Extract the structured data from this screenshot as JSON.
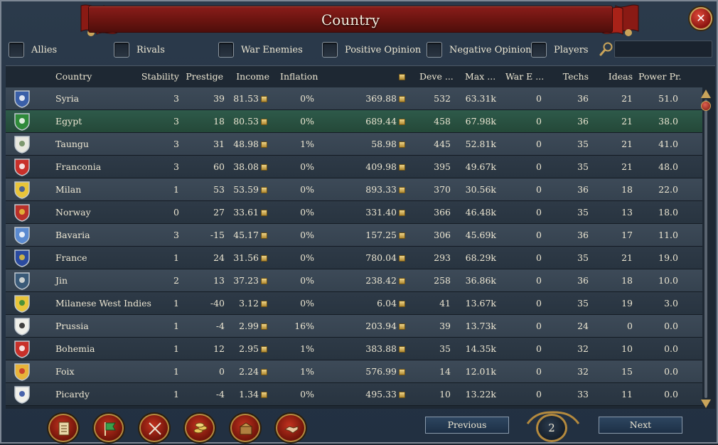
{
  "window": {
    "title": "Country"
  },
  "filters": [
    {
      "label": "Allies"
    },
    {
      "label": "Rivals"
    },
    {
      "label": "War Enemies"
    },
    {
      "label": "Positive Opinion"
    },
    {
      "label": "Negative Opinion"
    },
    {
      "label": "Players"
    }
  ],
  "search": {
    "value": "",
    "placeholder": ""
  },
  "columns": {
    "country": "Country",
    "stability": "Stability",
    "prestige": "Prestige",
    "income": "Income",
    "inflation": "Inflation",
    "treasury": "",
    "development": "Deve ...",
    "max_manpower": "Max ...",
    "war_exhaustion": "War E ...",
    "techs": "Techs",
    "ideas": "Ideas",
    "power_projection": "Power Pr."
  },
  "rows": [
    {
      "country": "Syria",
      "stability": "3",
      "prestige": "39",
      "income": "81.53",
      "inflation": "0%",
      "treasury": "369.88",
      "development": "532",
      "max_manpower": "63.31k",
      "war_exhaustion": "0",
      "techs": "36",
      "ideas": "21",
      "power_projection": "51.0",
      "flag_color": "#3a5fa8",
      "flag_accent": "#ffffff",
      "selected": false
    },
    {
      "country": "Egypt",
      "stability": "3",
      "prestige": "18",
      "income": "80.53",
      "inflation": "0%",
      "treasury": "689.44",
      "development": "458",
      "max_manpower": "67.98k",
      "war_exhaustion": "0",
      "techs": "36",
      "ideas": "21",
      "power_projection": "38.0",
      "flag_color": "#2f8a3a",
      "flag_accent": "#ffffff",
      "selected": true
    },
    {
      "country": "Taungu",
      "stability": "3",
      "prestige": "31",
      "income": "48.98",
      "inflation": "1%",
      "treasury": "58.98",
      "development": "445",
      "max_manpower": "52.81k",
      "war_exhaustion": "0",
      "techs": "35",
      "ideas": "21",
      "power_projection": "41.0",
      "flag_color": "#e8e8e0",
      "flag_accent": "#6a8a5a",
      "selected": false
    },
    {
      "country": "Franconia",
      "stability": "3",
      "prestige": "60",
      "income": "38.08",
      "inflation": "0%",
      "treasury": "409.98",
      "development": "395",
      "max_manpower": "49.67k",
      "war_exhaustion": "0",
      "techs": "35",
      "ideas": "21",
      "power_projection": "48.0",
      "flag_color": "#c8302a",
      "flag_accent": "#ffffff",
      "selected": false
    },
    {
      "country": "Milan",
      "stability": "1",
      "prestige": "53",
      "income": "53.59",
      "inflation": "0%",
      "treasury": "893.33",
      "development": "370",
      "max_manpower": "30.56k",
      "war_exhaustion": "0",
      "techs": "36",
      "ideas": "18",
      "power_projection": "22.0",
      "flag_color": "#e8c43a",
      "flag_accent": "#3050a0",
      "selected": false
    },
    {
      "country": "Norway",
      "stability": "0",
      "prestige": "27",
      "income": "33.61",
      "inflation": "0%",
      "treasury": "331.40",
      "development": "366",
      "max_manpower": "46.48k",
      "war_exhaustion": "0",
      "techs": "35",
      "ideas": "13",
      "power_projection": "18.0",
      "flag_color": "#b8302a",
      "flag_accent": "#e8c43a",
      "selected": false
    },
    {
      "country": "Bavaria",
      "stability": "3",
      "prestige": "-15",
      "income": "45.17",
      "inflation": "0%",
      "treasury": "157.25",
      "development": "306",
      "max_manpower": "45.69k",
      "war_exhaustion": "0",
      "techs": "36",
      "ideas": "17",
      "power_projection": "11.0",
      "flag_color": "#5a8ad0",
      "flag_accent": "#ffffff",
      "selected": false
    },
    {
      "country": "France",
      "stability": "1",
      "prestige": "24",
      "income": "31.56",
      "inflation": "0%",
      "treasury": "780.04",
      "development": "293",
      "max_manpower": "68.29k",
      "war_exhaustion": "0",
      "techs": "35",
      "ideas": "21",
      "power_projection": "19.0",
      "flag_color": "#2a4aa0",
      "flag_accent": "#e8c43a",
      "selected": false
    },
    {
      "country": "Jin",
      "stability": "2",
      "prestige": "13",
      "income": "37.23",
      "inflation": "0%",
      "treasury": "238.42",
      "development": "258",
      "max_manpower": "36.86k",
      "war_exhaustion": "0",
      "techs": "36",
      "ideas": "18",
      "power_projection": "10.0",
      "flag_color": "#3a5a78",
      "flag_accent": "#e8e8e0",
      "selected": false
    },
    {
      "country": "Milanese West Indies",
      "stability": "1",
      "prestige": "-40",
      "income": "3.12",
      "inflation": "0%",
      "treasury": "6.04",
      "development": "41",
      "max_manpower": "13.67k",
      "war_exhaustion": "0",
      "techs": "35",
      "ideas": "19",
      "power_projection": "3.0",
      "flag_color": "#e8c43a",
      "flag_accent": "#2f8a3a",
      "selected": false
    },
    {
      "country": "Prussia",
      "stability": "1",
      "prestige": "-4",
      "income": "2.99",
      "inflation": "16%",
      "treasury": "203.94",
      "development": "39",
      "max_manpower": "13.73k",
      "war_exhaustion": "0",
      "techs": "24",
      "ideas": "0",
      "power_projection": "0.0",
      "flag_color": "#f0f0ea",
      "flag_accent": "#222222",
      "selected": false
    },
    {
      "country": "Bohemia",
      "stability": "1",
      "prestige": "12",
      "income": "2.95",
      "inflation": "1%",
      "treasury": "383.88",
      "development": "35",
      "max_manpower": "14.35k",
      "war_exhaustion": "0",
      "techs": "32",
      "ideas": "10",
      "power_projection": "0.0",
      "flag_color": "#c8302a",
      "flag_accent": "#ffffff",
      "selected": false
    },
    {
      "country": "Foix",
      "stability": "1",
      "prestige": "0",
      "income": "2.24",
      "inflation": "1%",
      "treasury": "576.99",
      "development": "14",
      "max_manpower": "12.01k",
      "war_exhaustion": "0",
      "techs": "32",
      "ideas": "15",
      "power_projection": "0.0",
      "flag_color": "#e8b43a",
      "flag_accent": "#c8302a",
      "selected": false
    },
    {
      "country": "Picardy",
      "stability": "1",
      "prestige": "-4",
      "income": "1.34",
      "inflation": "0%",
      "treasury": "495.33",
      "development": "10",
      "max_manpower": "13.22k",
      "war_exhaustion": "0",
      "techs": "33",
      "ideas": "11",
      "power_projection": "0.0",
      "flag_color": "#f0f0ea",
      "flag_accent": "#2a4aa0",
      "selected": false
    }
  ],
  "bottom_buttons": [
    {
      "icon": "ledger-icon"
    },
    {
      "icon": "flag-icon"
    },
    {
      "icon": "crossed-swords-icon"
    },
    {
      "icon": "coins-icon"
    },
    {
      "icon": "trade-goods-icon"
    },
    {
      "icon": "handshake-icon"
    }
  ],
  "pagination": {
    "previous_label": "Previous",
    "page": "2",
    "next_label": "Next"
  },
  "colors": {
    "title_bar": "#7a1a14",
    "selected_row": "#2e5a4a",
    "gold": "#c9a45a"
  }
}
